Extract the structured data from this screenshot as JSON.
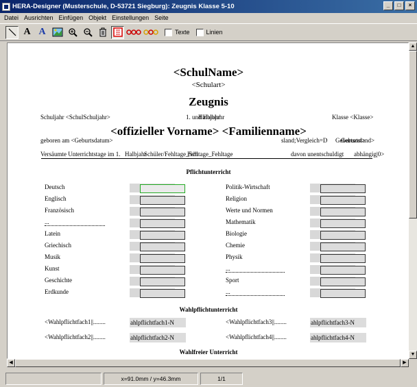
{
  "window": {
    "title": "HERA-Designer (Musterschule, D-53721 Siegburg): Zeugnis Klasse 5-10",
    "minimize": "_",
    "maximize": "□",
    "close": "×"
  },
  "menu": [
    "Datei",
    "Ausrichten",
    "Einfügen",
    "Objekt",
    "Einstellungen",
    "Seite"
  ],
  "toolbar": {
    "texte_label": "Texte",
    "linien_label": "Linien"
  },
  "document": {
    "school_name": "<SchulName>",
    "school_type": "<Schulart>",
    "heading": "Zeugnis",
    "schuljahr": "Schuljahr <SchulSchuljahr>",
    "halbjahr": "1. und Halbjahr",
    "halbjahr_overlap": "Halbjahr",
    "klasse": "Klasse <Klasse>",
    "student_name": "<offizieller Vorname> <Familienname>",
    "geboren": "geboren am <Geburtsdatum>",
    "geboren_right_a": "sland;Vergleich=D",
    "geboren_right_b": "Geburtsort>",
    "geboren_right_c": "Geburtsland>",
    "versaeumt": "Versäumte Unterrichtstage im 1.",
    "versaeumt_mid_a": "Halbjahr",
    "versaeumt_mid_b": "Schüler/Fehltage_Sch",
    "versaeumt_mid_c": "Fehltage_Fehltage",
    "davon": "davon unentschuldigt",
    "davon_end": "abhängig|0>",
    "section_pflicht": "Pflichtunterricht",
    "subjects_left": [
      "Deutsch",
      "Englisch",
      "Französisch",
      "...",
      "Latein",
      "Griechisch",
      "Musik",
      "Kunst",
      "Geschichte",
      "Erdkunde"
    ],
    "subjects_right": [
      "Politik-Wirtschaft",
      "Religion",
      "Werte und Normen",
      "Mathematik",
      "Biologie",
      "Chemie",
      "Physik",
      "...",
      "Sport",
      "..."
    ],
    "section_wahlpflicht": "Wahlpflichtunterricht",
    "wahl_labels": [
      "<Wahlpflichtfach1||........",
      "<Wahlpflichtfach2||........",
      "<Wahlpflichtfach3||........",
      "<Wahlpflichtfach4||........"
    ],
    "wahl_fields": [
      "ahlpflichtfach1-N",
      "ahlpflichtfach2-N",
      "ahlpflichtfach3-N",
      "ahlpflichtfach4-N"
    ],
    "section_wahlfrei": "Wahlfreier Unterricht"
  },
  "status": {
    "coords": "x=91.0mm / y=46.3mm",
    "page": "1/1"
  }
}
